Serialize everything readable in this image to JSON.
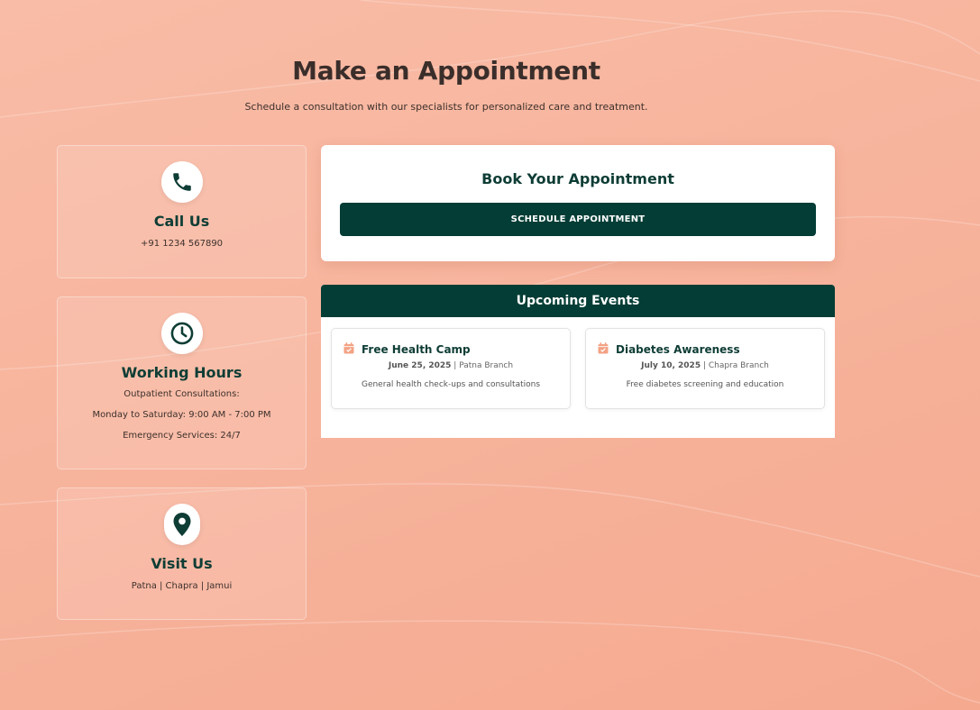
{
  "header": {
    "title": "Make an Appointment",
    "subtitle": "Schedule a consultation with our specialists for personalized care and treatment."
  },
  "info_cards": [
    {
      "icon": "phone-icon",
      "title": "Call Us",
      "lines": [
        "+91 1234 567890"
      ]
    },
    {
      "icon": "clock-icon",
      "title": "Working Hours",
      "lines": [
        "Outpatient Consultations:",
        "Monday to Saturday: 9:00 AM - 7:00 PM",
        "Emergency Services: 24/7"
      ]
    },
    {
      "icon": "map-pin-icon",
      "title": "Visit Us",
      "lines": [
        "Patna | Chapra | Jamui"
      ]
    }
  ],
  "booking": {
    "title": "Book Your Appointment",
    "button_label": "SCHEDULE APPOINTMENT"
  },
  "events": {
    "header": "Upcoming Events",
    "items": [
      {
        "icon": "calendar-check-icon",
        "title": "Free Health Camp",
        "date": "June 25, 2025",
        "separator": " | ",
        "location": "Patna Branch",
        "description": "General health check-ups and consultations"
      },
      {
        "icon": "calendar-check-icon",
        "title": "Diabetes Awareness",
        "date": "July 10, 2025",
        "separator": " | ",
        "location": "Chapra Branch",
        "description": "Free diabetes screening and education"
      }
    ]
  },
  "colors": {
    "background": "#f7b39c",
    "primary_dark": "#033d35",
    "heading_text": "#0e3d35",
    "accent_icon": "#f3a283"
  }
}
